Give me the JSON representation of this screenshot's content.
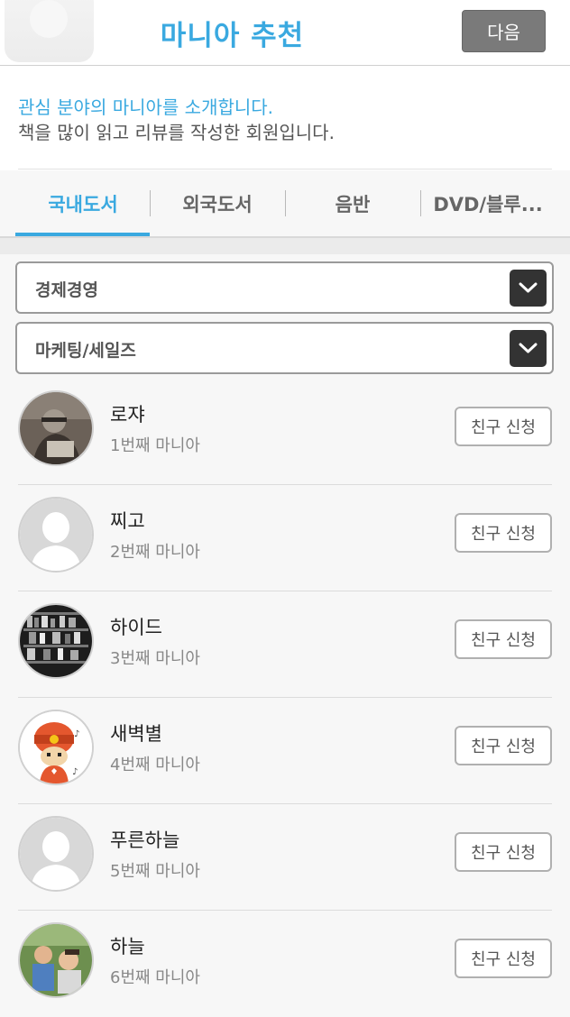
{
  "header": {
    "title": "마니아 추천",
    "next_label": "다음"
  },
  "intro": {
    "line1": "관심 분야의 마니아를 소개합니다.",
    "line2": "책을 많이 읽고 리뷰를 작성한 회원입니다."
  },
  "tabs": [
    {
      "label": "국내도서",
      "active": true
    },
    {
      "label": "외국도서",
      "active": false
    },
    {
      "label": "음반",
      "active": false
    },
    {
      "label": "DVD/블루...",
      "active": false
    }
  ],
  "filters": {
    "category": {
      "selected": "경제경영"
    },
    "subcategory": {
      "selected": "마케팅/세일즈"
    }
  },
  "manias": [
    {
      "name": "로쟈",
      "rank": "1번째 마니아",
      "button": "친구 신청",
      "avatar": "photo-man-reading"
    },
    {
      "name": "찌고",
      "rank": "2번째 마니아",
      "button": "친구 신청",
      "avatar": "default-person-icon"
    },
    {
      "name": "하이드",
      "rank": "3번째 마니아",
      "button": "친구 신청",
      "avatar": "photo-bookshelf"
    },
    {
      "name": "새벽별",
      "rank": "4번째 마니아",
      "button": "친구 신청",
      "avatar": "cartoon-character"
    },
    {
      "name": "푸른하늘",
      "rank": "5번째 마니아",
      "button": "친구 신청",
      "avatar": "default-person-icon"
    },
    {
      "name": "하늘",
      "rank": "6번째 마니아",
      "button": "친구 신청",
      "avatar": "photo-children"
    }
  ],
  "colors": {
    "accent": "#3aa9e0",
    "next_button": "#7a7a7a",
    "dropdown_button": "#333333"
  }
}
